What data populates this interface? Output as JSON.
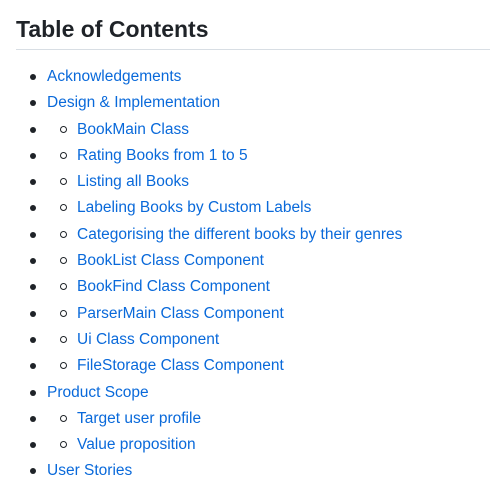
{
  "heading": "Table of Contents",
  "colors": {
    "link": "#0969da",
    "text": "#1f2328",
    "divider": "#d8dee4"
  },
  "toc": [
    {
      "level": 1,
      "label": "Acknowledgements"
    },
    {
      "level": 1,
      "label": "Design & Implementation"
    },
    {
      "level": 2,
      "label": "BookMain Class"
    },
    {
      "level": 2,
      "label": "Rating Books from 1 to 5"
    },
    {
      "level": 2,
      "label": "Listing all Books"
    },
    {
      "level": 2,
      "label": "Labeling Books by Custom Labels"
    },
    {
      "level": 2,
      "label": "Categorising the different books by their genres"
    },
    {
      "level": 2,
      "label": "BookList Class Component"
    },
    {
      "level": 2,
      "label": "BookFind Class Component"
    },
    {
      "level": 2,
      "label": "ParserMain Class Component"
    },
    {
      "level": 2,
      "label": "Ui Class Component"
    },
    {
      "level": 2,
      "label": "FileStorage Class Component"
    },
    {
      "level": 1,
      "label": "Product Scope"
    },
    {
      "level": 2,
      "label": "Target user profile"
    },
    {
      "level": 2,
      "label": "Value proposition"
    },
    {
      "level": 1,
      "label": "User Stories"
    }
  ]
}
